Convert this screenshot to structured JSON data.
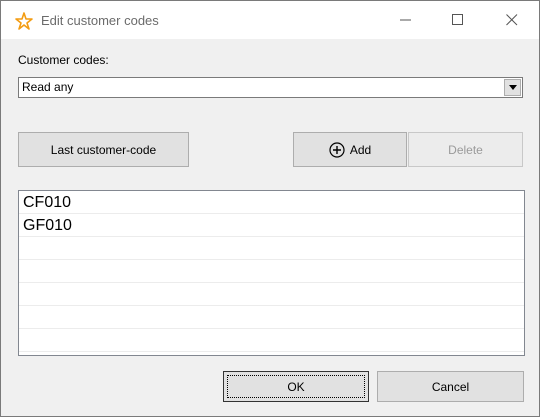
{
  "window": {
    "title": "Edit customer codes",
    "icon": "star-outline-icon",
    "controls": {
      "minimize": "minimize-icon",
      "maximize": "maximize-icon",
      "close": "close-icon"
    }
  },
  "form": {
    "codes_label": "Customer codes:",
    "combo_value": "Read any"
  },
  "buttons": {
    "last_code": "Last customer-code",
    "add": "Add",
    "delete": "Delete",
    "ok": "OK",
    "cancel": "Cancel"
  },
  "codes_list": [
    "CF010",
    "GF010",
    "",
    "",
    "",
    "",
    ""
  ],
  "colors": {
    "accent_icon": "#f39c12",
    "disabled_text": "#9a9a9a"
  }
}
